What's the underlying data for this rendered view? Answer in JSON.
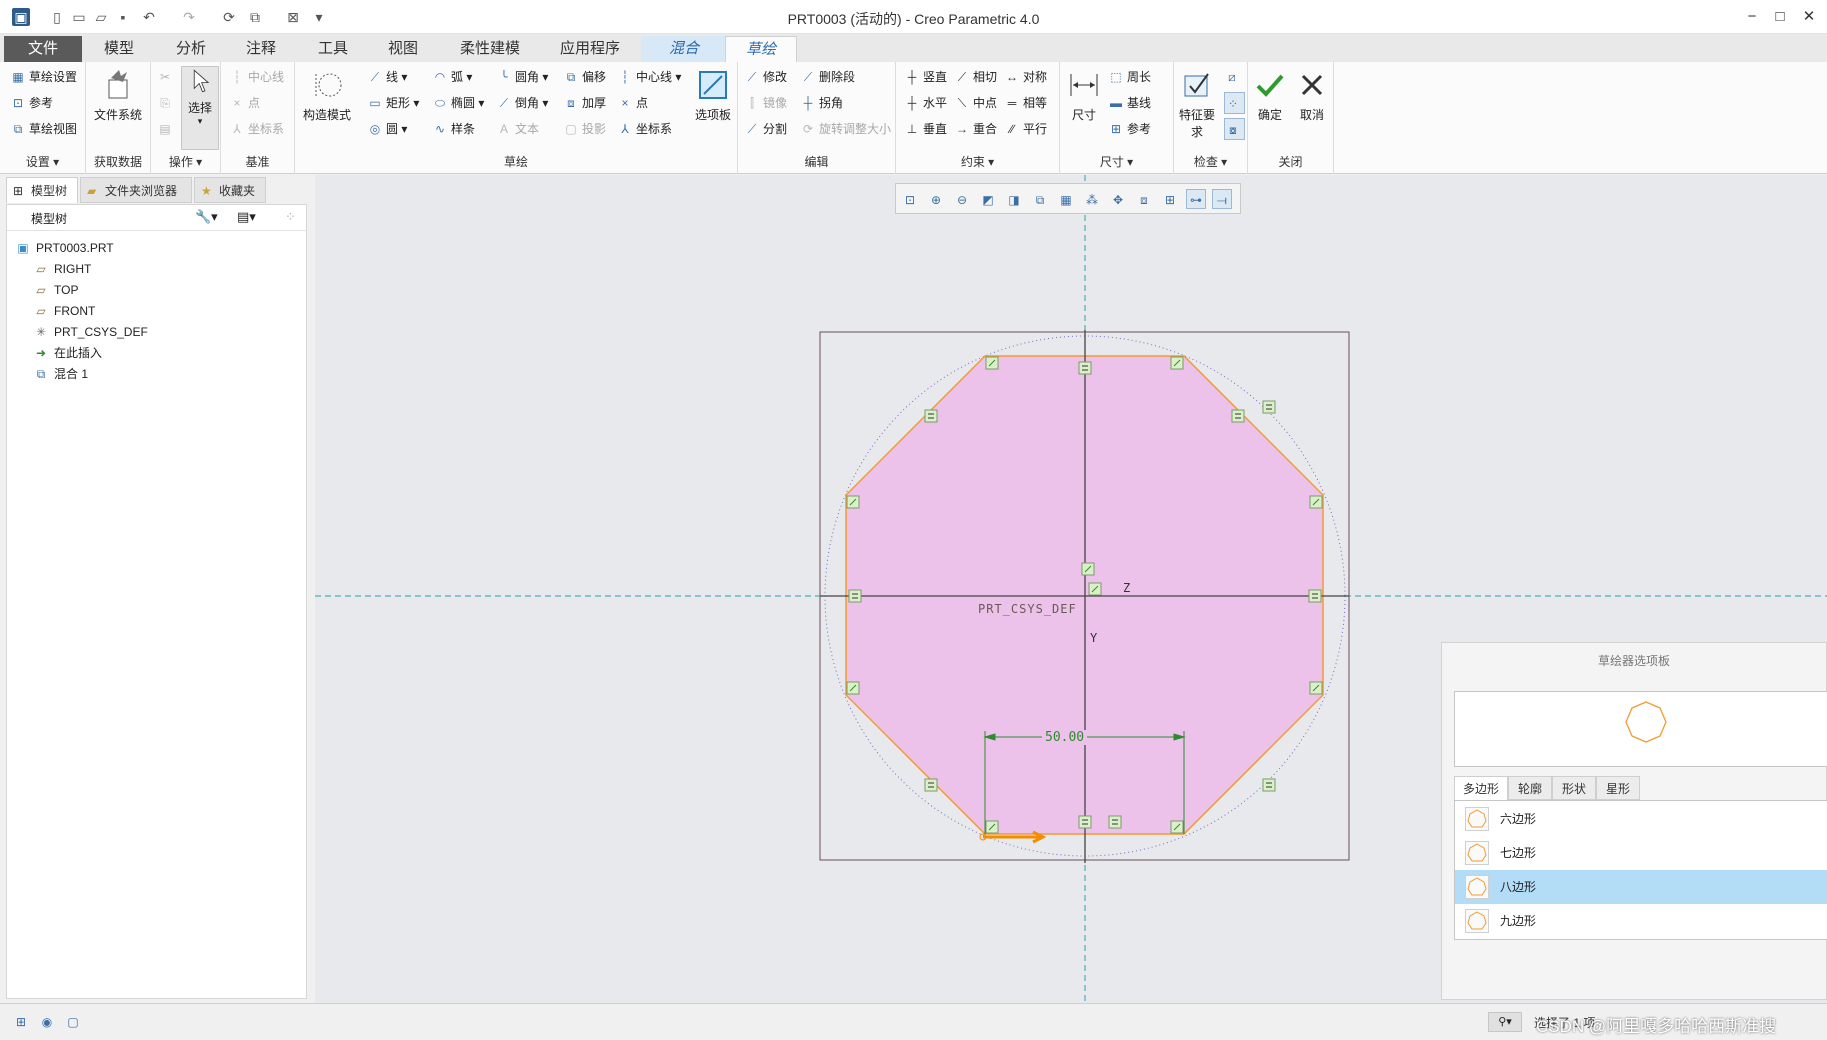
{
  "window": {
    "title": "PRT0003 (活动的) - Creo Parametric 4.0",
    "controls": {
      "minimize": "−",
      "maximize": "□",
      "close": "✕"
    }
  },
  "quick_access": {
    "icons": [
      "app-menu-icon",
      "new-icon",
      "new-file-icon",
      "open-icon",
      "save-icon",
      "undo-icon",
      "redo-icon",
      "regenerate-icon",
      "windows-icon",
      "close-window-icon",
      "customize-icon"
    ]
  },
  "tabs": [
    "文件",
    "模型",
    "分析",
    "注释",
    "工具",
    "视图",
    "柔性建模",
    "应用程序",
    "混合",
    "草绘"
  ],
  "ribbon": {
    "setup": {
      "items": [
        "草绘设置",
        "参考",
        "草绘视图"
      ],
      "label": "设置"
    },
    "get_data": {
      "button": "文件系统",
      "label": "获取数据"
    },
    "operations": {
      "button": "选择",
      "label": "操作"
    },
    "datum": {
      "items": [
        "中心线",
        "点",
        "坐标系"
      ],
      "label": "基准"
    },
    "sketch": {
      "construction": "构造模式",
      "col1": [
        "线",
        "矩形",
        "圆"
      ],
      "col2": [
        "弧",
        "椭圆",
        "样条"
      ],
      "col3": [
        "圆角",
        "倒角",
        "文本"
      ],
      "col4": [
        "偏移",
        "加厚",
        "投影"
      ],
      "col5": [
        "中心线",
        "点",
        "坐标系"
      ],
      "palette": "选项板",
      "label": "草绘"
    },
    "edit": {
      "col1": [
        "修改",
        "镜像",
        "分割"
      ],
      "col2": [
        "删除段",
        "拐角",
        "旋转调整大小"
      ],
      "label": "编辑"
    },
    "constrain": {
      "col1": [
        "竖直",
        "水平",
        "垂直"
      ],
      "col2": [
        "相切",
        "中点",
        "重合"
      ],
      "col3": [
        "对称",
        "相等",
        "平行"
      ],
      "label": "约束"
    },
    "dimension": {
      "button": "尺寸",
      "items": [
        "周长",
        "基线",
        "参考"
      ],
      "label": "尺寸"
    },
    "inspect": {
      "button": "特征要求",
      "label": "检查"
    },
    "close": {
      "ok": "确定",
      "cancel": "取消",
      "label": "关闭"
    }
  },
  "left_panel": {
    "tabs": [
      "模型树",
      "文件夹浏览器",
      "收藏夹"
    ],
    "tree_header": "模型树",
    "tree": [
      {
        "label": "PRT0003.PRT",
        "icon": "part-icon"
      },
      {
        "label": "RIGHT",
        "icon": "datum-plane-icon"
      },
      {
        "label": "TOP",
        "icon": "datum-plane-icon"
      },
      {
        "label": "FRONT",
        "icon": "datum-plane-icon"
      },
      {
        "label": "PRT_CSYS_DEF",
        "icon": "csys-icon"
      },
      {
        "label": "在此插入",
        "icon": "insert-arrow-icon"
      },
      {
        "label": "混合 1",
        "icon": "blend-icon"
      }
    ]
  },
  "sketch": {
    "dimension_value": "50.00",
    "csys_label": "PRT_CSYS_DEF",
    "axis_z": "Z",
    "axis_y": "Y",
    "colors": {
      "fill": "#ecc2ea",
      "edge": "#f29a33",
      "centerline": "#2aa3a9",
      "constraint": "#3a8a2a",
      "dimension": "#2f8a2f"
    }
  },
  "palette": {
    "title": "草绘器选项板",
    "tabs": [
      "多边形",
      "轮廓",
      "形状",
      "星形"
    ],
    "items": [
      "六边形",
      "七边形",
      "八边形",
      "九边形"
    ],
    "selected": "八边形"
  },
  "statusbar": {
    "filter": "选择了 1 项",
    "watermark": "CSDN @阿里嘎多哈哈西斯准搜"
  }
}
